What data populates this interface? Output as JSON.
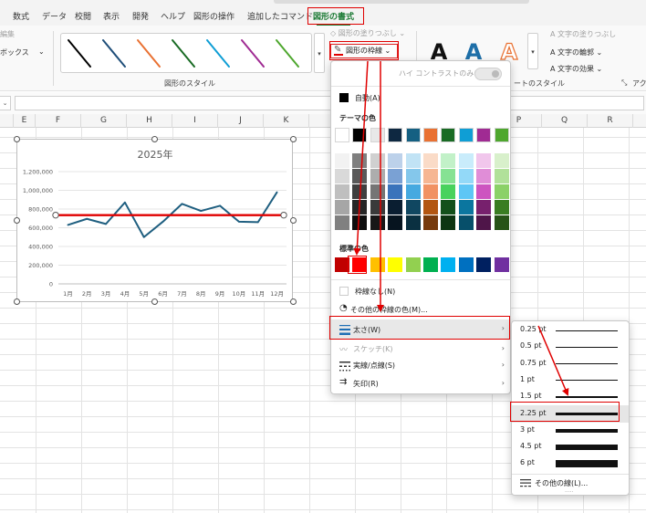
{
  "tabs": [
    "数式",
    "データ",
    "校閲",
    "表示",
    "開発",
    "ヘルプ",
    "図形の操作",
    "追加したコマンド",
    "図形の書式"
  ],
  "ribbon": {
    "left_edit": "編集",
    "left_box": "ボックス",
    "styles_group": "図形のスタイル",
    "fill_label": "図形の塗りつぶし",
    "outline_label": "図形の枠線",
    "wordart_group": "ワードアートのスタイル",
    "wordart_group_short": "ートのスタイル",
    "text_fill": "文字の塗りつぶし",
    "text_outline": "文字の輪郭",
    "text_effect": "文字の効果",
    "wordart_glyph": "A",
    "access_cut": "アクセ"
  },
  "columns": [
    "E",
    "F",
    "G",
    "H",
    "I",
    "J",
    "K",
    "P",
    "Q",
    "R"
  ],
  "namebox": "",
  "menu": {
    "high_contrast": "ハイ コントラストのみ(H)",
    "auto": "自動(A)",
    "theme_colors": "テーマの色",
    "standard_colors": "標準の色",
    "no_outline": "枠線なし(N)",
    "more_colors": "その他の枠線の色(M)...",
    "weight": "太さ(W)",
    "sketch": "スケッチ(K)",
    "dashes": "実線/点線(S)",
    "arrows": "矢印(R)"
  },
  "theme_top": [
    "#ffffff",
    "#000000",
    "#e8e8e8",
    "#0e2841",
    "#156082",
    "#e97132",
    "#196b24",
    "#0f9ed5",
    "#a02b93",
    "#4ea72e"
  ],
  "theme_shades": [
    [
      "#f2f2f2",
      "#7f7f7f",
      "#d0d0d0",
      "#bcd1ea",
      "#c1e3f5",
      "#fadbc7",
      "#c2f1c8",
      "#c9ecfb",
      "#f1c6ec",
      "#d8f0cb"
    ],
    [
      "#d9d9d9",
      "#595959",
      "#adadad",
      "#7aa1d4",
      "#84c7eb",
      "#f6b692",
      "#86e293",
      "#93d9f8",
      "#e08dd7",
      "#b1e19a"
    ],
    [
      "#bfbfbf",
      "#3f3f3f",
      "#757575",
      "#3a73bb",
      "#45a9e0",
      "#f19263",
      "#48d25d",
      "#5ec6f5",
      "#cd54c0",
      "#8bd168"
    ],
    [
      "#a6a6a6",
      "#262626",
      "#3a3a3a",
      "#0a1e31",
      "#104761",
      "#b35611",
      "#13501b",
      "#0b769f",
      "#77206d",
      "#3a7d22"
    ],
    [
      "#808080",
      "#0d0d0d",
      "#171717",
      "#07141f",
      "#0a3041",
      "#773a0c",
      "#0d3512",
      "#074f6a",
      "#4f1549",
      "#275317"
    ]
  ],
  "standard": [
    "#c00000",
    "#ff0000",
    "#ffc000",
    "#ffff00",
    "#92d050",
    "#00b050",
    "#00b0f0",
    "#0070c0",
    "#002060",
    "#7030a0"
  ],
  "weights": [
    {
      "label": "0.25 pt",
      "pt": 0.25
    },
    {
      "label": "0.5 pt",
      "pt": 0.5
    },
    {
      "label": "0.75 pt",
      "pt": 0.75
    },
    {
      "label": "1 pt",
      "pt": 1
    },
    {
      "label": "1.5 pt",
      "pt": 1.5
    },
    {
      "label": "2.25 pt",
      "pt": 2.25
    },
    {
      "label": "3 pt",
      "pt": 3
    },
    {
      "label": "4.5 pt",
      "pt": 4.5
    },
    {
      "label": "6 pt",
      "pt": 6
    }
  ],
  "selected_weight": "2.25 pt",
  "other_lines": "その他の線(L)...",
  "gallery_colors": [
    "#000000",
    "#1f4e79",
    "#e97132",
    "#196b24",
    "#0f9ed5",
    "#a02b93",
    "#4ea72e"
  ],
  "chart_data": {
    "type": "line",
    "title": "2025年",
    "categories": [
      "1月",
      "2月",
      "3月",
      "4月",
      "5月",
      "6月",
      "7月",
      "8月",
      "9月",
      "10月",
      "11月",
      "12月"
    ],
    "series": [
      {
        "values": [
          630000,
          695000,
          640000,
          870000,
          500000,
          665000,
          855000,
          780000,
          835000,
          665000,
          660000,
          980000
        ],
        "color": "#1f5f80"
      }
    ],
    "reference_line": {
      "value": 735000,
      "color": "#e00000"
    },
    "yticks": [
      "0",
      "200,000",
      "400,000",
      "600,000",
      "800,000",
      "1,000,000",
      "1,200,000"
    ],
    "ylim": [
      0,
      1200000
    ],
    "grid": true
  }
}
